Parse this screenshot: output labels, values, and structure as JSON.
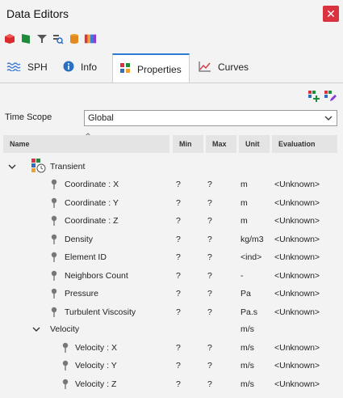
{
  "window": {
    "title": "Data Editors",
    "close_glyph": "✕"
  },
  "toolbar": {
    "icons": [
      "red-cube-icon",
      "green-flag-icon",
      "filter-icon",
      "search-layers-icon",
      "database-icon",
      "color-map-icon"
    ]
  },
  "tabs": [
    {
      "label": "SPH",
      "icon": "waves-icon",
      "active": false
    },
    {
      "label": "Info",
      "icon": "info-icon",
      "active": false
    },
    {
      "label": "Properties",
      "icon": "properties-icon",
      "active": true
    },
    {
      "label": "Curves",
      "icon": "curve-icon",
      "active": false
    }
  ],
  "scope": {
    "label": "Time Scope",
    "value": "Global"
  },
  "columns": {
    "name": "Name",
    "min": "Min",
    "max": "Max",
    "unit": "Unit",
    "evaluation": "Evaluation"
  },
  "tree": {
    "root": {
      "label": "Transient"
    },
    "rows": [
      {
        "name": "Coordinate : X",
        "min": "?",
        "max": "?",
        "unit": "m",
        "evaluation": "<Unknown>"
      },
      {
        "name": "Coordinate : Y",
        "min": "?",
        "max": "?",
        "unit": "m",
        "evaluation": "<Unknown>"
      },
      {
        "name": "Coordinate : Z",
        "min": "?",
        "max": "?",
        "unit": "m",
        "evaluation": "<Unknown>"
      },
      {
        "name": "Density",
        "min": "?",
        "max": "?",
        "unit": "kg/m3",
        "evaluation": "<Unknown>"
      },
      {
        "name": "Element ID",
        "min": "?",
        "max": "?",
        "unit": "<ind>",
        "evaluation": "<Unknown>"
      },
      {
        "name": "Neighbors Count",
        "min": "?",
        "max": "?",
        "unit": "-",
        "evaluation": "<Unknown>"
      },
      {
        "name": "Pressure",
        "min": "?",
        "max": "?",
        "unit": "Pa",
        "evaluation": "<Unknown>"
      },
      {
        "name": "Turbulent Viscosity",
        "min": "?",
        "max": "?",
        "unit": "Pa.s",
        "evaluation": "<Unknown>"
      }
    ],
    "velocity": {
      "label": "Velocity",
      "unit": "m/s",
      "rows": [
        {
          "name": "Velocity : X",
          "min": "?",
          "max": "?",
          "unit": "m/s",
          "evaluation": "<Unknown>"
        },
        {
          "name": "Velocity : Y",
          "min": "?",
          "max": "?",
          "unit": "m/s",
          "evaluation": "<Unknown>"
        },
        {
          "name": "Velocity : Z",
          "min": "?",
          "max": "?",
          "unit": "m/s",
          "evaluation": "<Unknown>"
        }
      ]
    }
  }
}
